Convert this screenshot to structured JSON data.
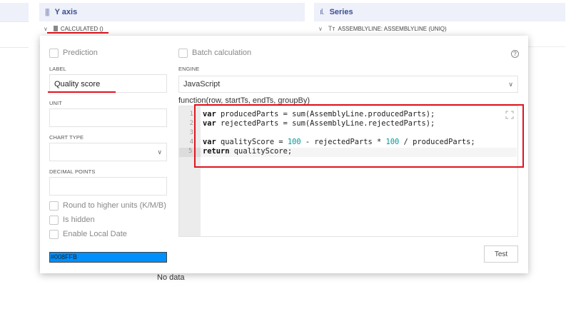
{
  "background": {
    "yaxis_title": "Y axis",
    "yaxis_icon": "columns-icon",
    "calculated_label": "CALCULATED ()",
    "series_title": "Series",
    "series_icon": "bar-chart-icon",
    "series_row_label": "ASSEMBLYLINE: ASSEMBLYLINE (UNIQ)",
    "no_data": "No data"
  },
  "modal": {
    "prediction_label": "Prediction",
    "label_title": "LABEL",
    "label_value": "Quality score",
    "unit_title": "UNIT",
    "unit_value": "",
    "chart_type_title": "CHART TYPE",
    "chart_type_value": "",
    "decimal_points_title": "DECIMAL POINTS",
    "decimal_points_value": "",
    "round_label": "Round to higher units (K/M/B)",
    "is_hidden_label": "Is hidden",
    "enable_local_date_label": "Enable Local Date",
    "color_value": "#008FFB",
    "color_hex": "#008ffb",
    "batch_label": "Batch calculation",
    "engine_title": "ENGINE",
    "engine_value": "JavaScript",
    "function_signature": "function(row, startTs, endTs, groupBy)",
    "code_lines": [
      "var producedParts = sum(AssemblyLine.producedParts);",
      "var rejectedParts = sum(AssemblyLine.rejectedParts);",
      "",
      "var qualityScore = 100 - rejectedParts * 100 / producedParts;",
      "return qualityScore;"
    ],
    "line_numbers": [
      "1",
      "2",
      "3",
      "4",
      "5"
    ],
    "active_line": 5,
    "test_label": "Test",
    "highlight_color": "#e0141e"
  }
}
